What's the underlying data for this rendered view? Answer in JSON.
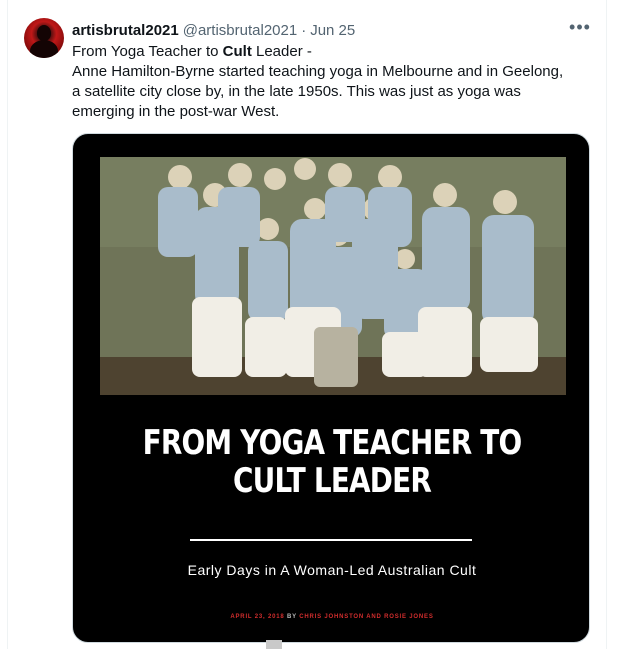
{
  "tweet": {
    "display_name": "artisbrutal2021",
    "handle": "@artisbrutal2021",
    "separator": "·",
    "date": "Jun 25",
    "more_label": "•••",
    "text_line1_a": "From Yoga Teacher to ",
    "text_line1_cult": "Cult",
    "text_line1_b": " Leader -",
    "text_line2": "Anne Hamilton-Byrne started teaching yoga in Melbourne and in  Geelong,",
    "text_line3": "a satellite city close by, in the late 1950s. This was just as  yoga was",
    "text_line4": "emerging in the post-war West."
  },
  "media": {
    "headline_line1": "FROM YOGA TEACHER TO",
    "headline_line2": "CULT LEADER",
    "subtitle": "Early Days in A Woman-Led Australian Cult",
    "byline_date": "APRIL 23, 2018",
    "byline_by": " BY ",
    "byline_authors": "CHRIS JOHNSTON AND ROSIE JONES"
  },
  "icons": {
    "more": "ellipsis-icon",
    "avatar": "silhouette-avatar"
  },
  "colors": {
    "text": "#0f1419",
    "secondary": "#536471",
    "media_bg": "#000000",
    "byline_red": "#d22d2d"
  }
}
